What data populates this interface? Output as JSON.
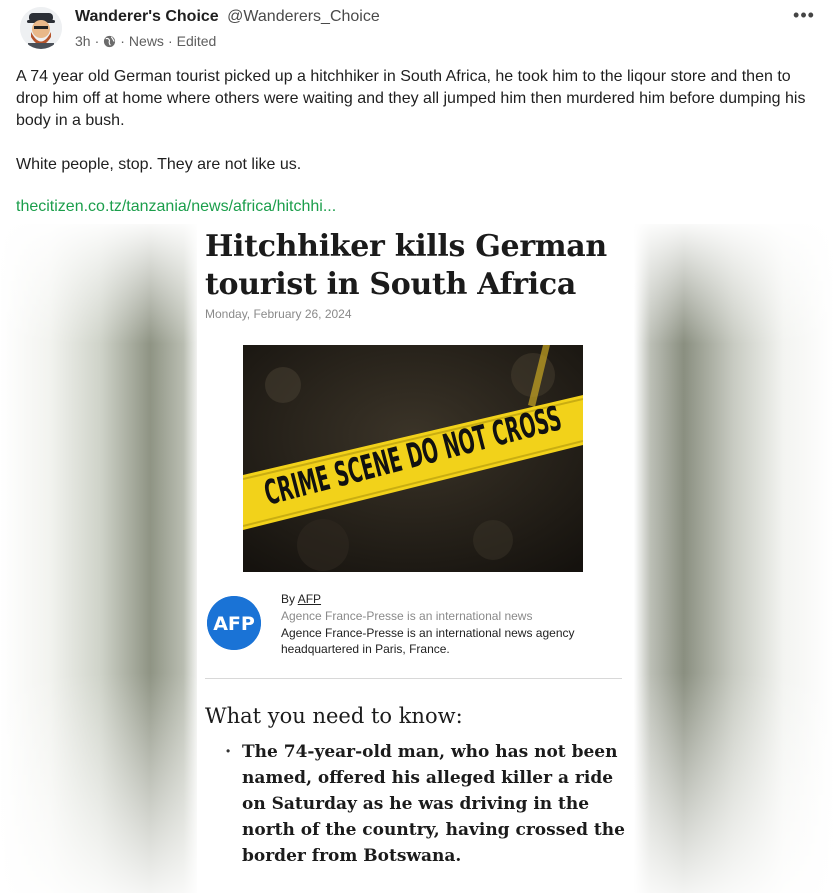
{
  "post": {
    "author_name": "Wanderer's Choice",
    "author_handle": "@Wanderers_Choice",
    "time": "3h",
    "separator": "·",
    "category": "News",
    "edited": "Edited",
    "more_icon": "more-horizontal-icon",
    "more_glyph": "•••",
    "body_paragraphs": [
      "A 74 year old German tourist picked up a hitchhiker in South Africa, he took him to the liqour store and then to drop him off at home where others were waiting and they all jumped him then murdered him before dumping his body in a bush.",
      "White people, stop. They are not like us."
    ],
    "link_text": "thecitizen.co.tz/tanzania/news/africa/hitchhi..."
  },
  "article": {
    "headline": "Hitchhiker kills German tourist in South Africa",
    "date": "Monday, February 26, 2024",
    "photo_caption_tape": "CRIME SCENE DO NOT CROSS",
    "byline_prefix": "By",
    "byline_author": "AFP",
    "logo_text": "AFP",
    "agency_short": "Agence France-Presse is an international news",
    "agency_long": "Agence France-Presse is an international news agency headquartered in Paris, France.",
    "need_title": "What you need to know:",
    "bullet_marker": "•",
    "bullet_text": "The 74-year-old man, who has not been named, offered his alleged killer a ride on Saturday as he was driving in the north of the country, having crossed the border from Botswana."
  },
  "colors": {
    "link": "#1b9e4b",
    "tape": "#f2d21a",
    "afp_blue": "#1a73d6"
  }
}
